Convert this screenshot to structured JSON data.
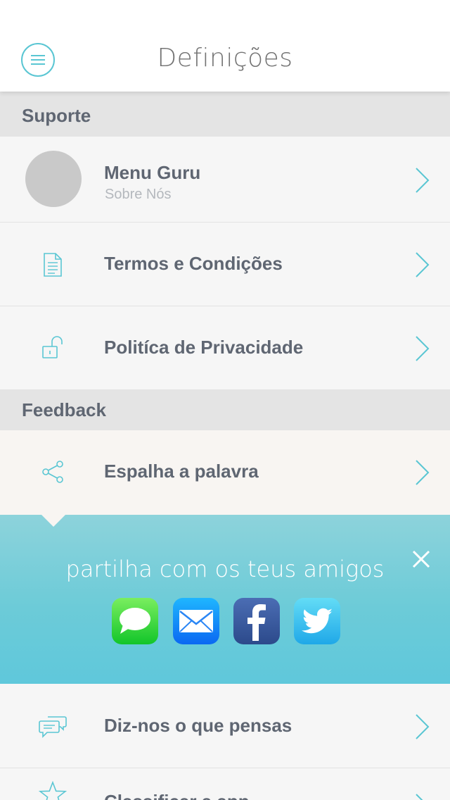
{
  "header": {
    "title": "Definições",
    "menu_icon": "hamburger-icon"
  },
  "sections": {
    "support": "Suporte",
    "feedback": "Feedback"
  },
  "support_items": {
    "about": {
      "title": "Menu Guru",
      "subtitle": "Sobre Nós"
    },
    "terms": {
      "title": "Termos e Condições",
      "icon": "document-icon"
    },
    "privacy": {
      "title": "Politíca de Privacidade",
      "icon": "unlocked-padlock-icon"
    }
  },
  "feedback_items": {
    "spread": {
      "title": "Espalha a palavra",
      "icon": "share-icon"
    },
    "tell_us": {
      "title": "Diz-nos o que pensas",
      "icon": "chat-bubbles-icon"
    },
    "rate": {
      "title": "Classificar a app",
      "icon": "star-icon"
    }
  },
  "share_panel": {
    "title": "partilha com os teus amigos",
    "apps": [
      "messages-icon",
      "mail-icon",
      "facebook-icon",
      "twitter-icon"
    ]
  },
  "colors": {
    "accent": "#5ac6d3",
    "text": "#5f6672",
    "section_bg": "#e4e4e4",
    "panel": "#6ccbd8"
  }
}
